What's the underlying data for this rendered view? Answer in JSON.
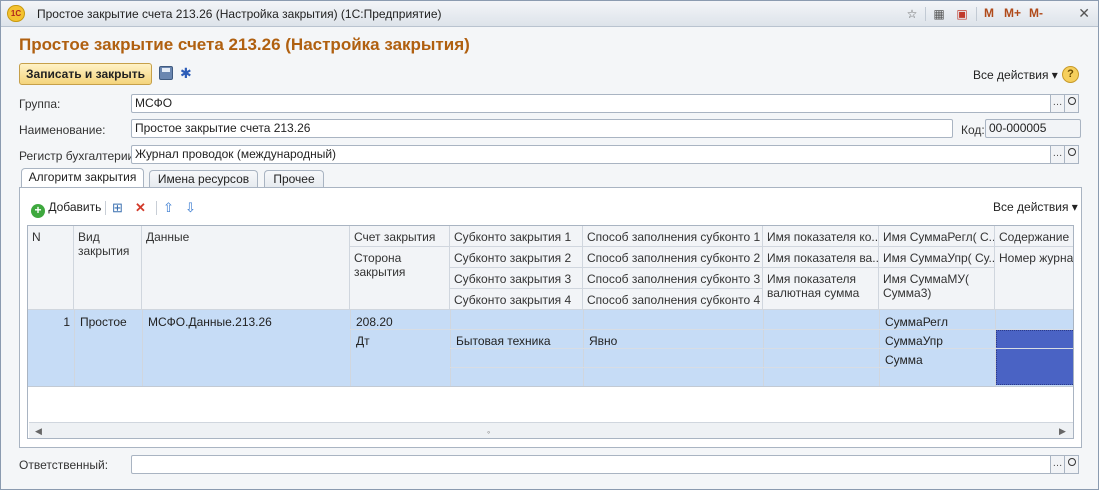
{
  "window": {
    "app_logo": "1С",
    "title": "Простое закрытие счета 213.26 (Настройка закрытия)  (1С:Предприятие)",
    "toolbar_m": [
      "M",
      "M+",
      "M-"
    ]
  },
  "form": {
    "heading": "Простое закрытие счета 213.26 (Настройка закрытия)",
    "save_close_label": "Записать и закрыть",
    "all_actions_label": "Все действия ▾",
    "help_label": "?"
  },
  "fields": {
    "group": {
      "label": "Группа:",
      "value": "МСФО"
    },
    "name": {
      "label": "Наименование:",
      "value": "Простое закрытие счета 213.26"
    },
    "code": {
      "label": "Код:",
      "value": "00-000005"
    },
    "register": {
      "label": "Регистр бухгалтерии:",
      "value": "Журнал проводок (международный)"
    },
    "responsible": {
      "label": "Ответственный:",
      "value": ""
    }
  },
  "tabs": [
    {
      "label": "Алгоритм закрытия",
      "active": true
    },
    {
      "label": "Имена ресурсов",
      "active": false
    },
    {
      "label": "Прочее",
      "active": false
    }
  ],
  "table_toolbar": {
    "add_label": "Добавить",
    "all_actions_label": "Все действия ▾"
  },
  "table": {
    "headers": {
      "n": "N",
      "kind": "Вид закрытия",
      "data": "Данные",
      "account": "Счет закрытия",
      "side": "Сторона закрытия",
      "subconto": [
        "Субконто закрытия 1",
        "Субконто закрытия 2",
        "Субконто закрытия 3",
        "Субконто закрытия 4"
      ],
      "fill": [
        "Способ заполнения субконто 1",
        "Способ заполнения субконто 2",
        "Способ заполнения субконто 3",
        "Способ заполнения субконто 4"
      ],
      "ind_qty": "Имя показателя ко...",
      "ind_val": "Имя показателя ва...",
      "ind_cur": "Имя показателя валютная сумма",
      "sum_reg": "Имя СуммаРегл( С...",
      "sum_upr": "Имя СуммаУпр( Су...",
      "sum_mu": "Имя СуммаМУ( Сумма3)",
      "content": "Содержание",
      "journal": "Номер журнал"
    },
    "row": {
      "n": "1",
      "kind": "Простое",
      "data": "МСФО.Данные.213.26",
      "account": "208.20",
      "side": "Дт",
      "subconto1": "Бытовая техника",
      "fill1": "Явно",
      "sum_reg": "СуммаРегл",
      "sum_upr": "СуммаУпр",
      "sum": "Сумма"
    }
  },
  "colors": {
    "heading": "#b06010",
    "selection": "#c6dcf6",
    "selected_cell": "#4a63c4"
  }
}
